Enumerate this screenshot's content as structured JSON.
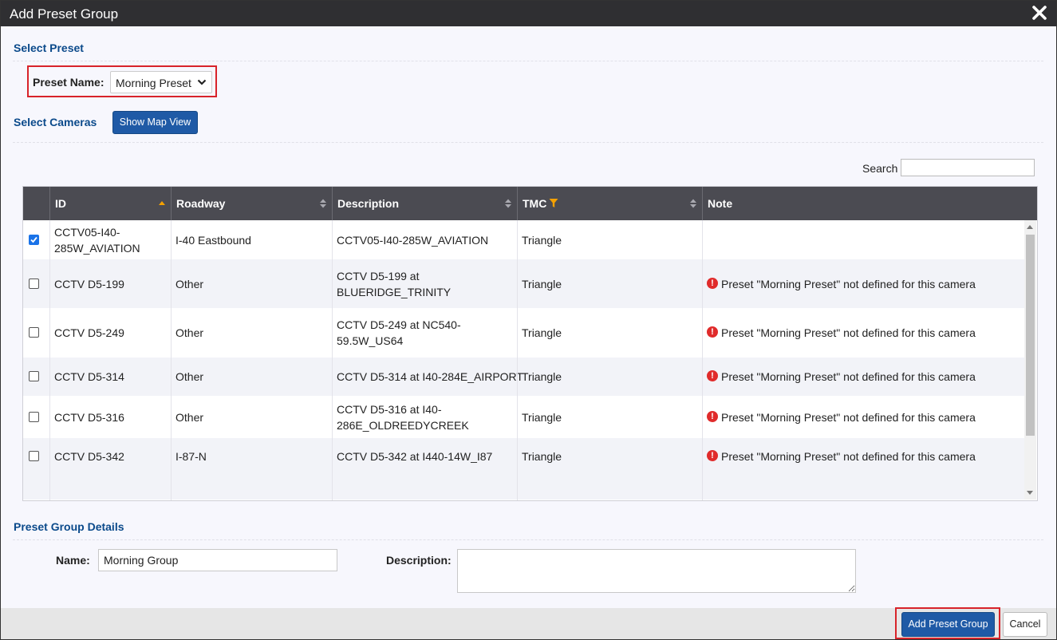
{
  "dialog": {
    "title": "Add Preset Group"
  },
  "select_preset": {
    "heading": "Select Preset",
    "label": "Preset Name:",
    "value": "Morning Preset"
  },
  "select_cameras": {
    "heading": "Select Cameras",
    "map_button": "Show Map View"
  },
  "search": {
    "label": "Search",
    "value": ""
  },
  "table": {
    "columns": [
      "ID",
      "Roadway",
      "Description",
      "TMC",
      "Note"
    ],
    "rows": [
      {
        "checked": true,
        "id": [
          "CCTV05-I40-",
          "285W_AVIATION"
        ],
        "roadway": "I-40 Eastbound",
        "description": [
          "CCTV05-I40-285W_AVIATION"
        ],
        "tmc": "Triangle",
        "note": ""
      },
      {
        "checked": false,
        "id": [
          "CCTV D5-199"
        ],
        "roadway": "Other",
        "description": [
          "CCTV D5-199 at",
          "BLUERIDGE_TRINITY"
        ],
        "tmc": "Triangle",
        "note": "Preset \"Morning Preset\" not defined for this camera"
      },
      {
        "checked": false,
        "id": [
          "CCTV D5-249"
        ],
        "roadway": "Other",
        "description": [
          "CCTV D5-249 at NC540-",
          "59.5W_US64"
        ],
        "tmc": "Triangle",
        "note": "Preset \"Morning Preset\" not defined for this camera"
      },
      {
        "checked": false,
        "id": [
          "CCTV D5-314"
        ],
        "roadway": "Other",
        "description": [
          "CCTV D5-314 at I40-284E_AIRPORT"
        ],
        "tmc": "Triangle",
        "note": "Preset \"Morning Preset\" not defined for this camera"
      },
      {
        "checked": false,
        "id": [
          "CCTV D5-316"
        ],
        "roadway": "Other",
        "description": [
          "CCTV D5-316 at I40-",
          "286E_OLDREEDYCREEK"
        ],
        "tmc": "Triangle",
        "note": "Preset \"Morning Preset\" not defined for this camera"
      },
      {
        "checked": false,
        "id": [
          "CCTV D5-342"
        ],
        "roadway": "I-87-N",
        "description": [
          "CCTV D5-342 at I440-14W_I87"
        ],
        "tmc": "Triangle",
        "note": "Preset \"Morning Preset\" not defined for this camera"
      }
    ]
  },
  "details": {
    "heading": "Preset Group Details",
    "name_label": "Name:",
    "name_value": "Morning Group",
    "description_label": "Description:",
    "description_value": ""
  },
  "footer": {
    "add_button": "Add Preset Group",
    "cancel_button": "Cancel"
  },
  "colors": {
    "title_bar": "#2f2f32",
    "primary": "#1f5aa6",
    "heading": "#0b4a8b",
    "highlight": "#d8232a",
    "filter_icon": "#f5a100",
    "warning": "#e02b2b"
  }
}
